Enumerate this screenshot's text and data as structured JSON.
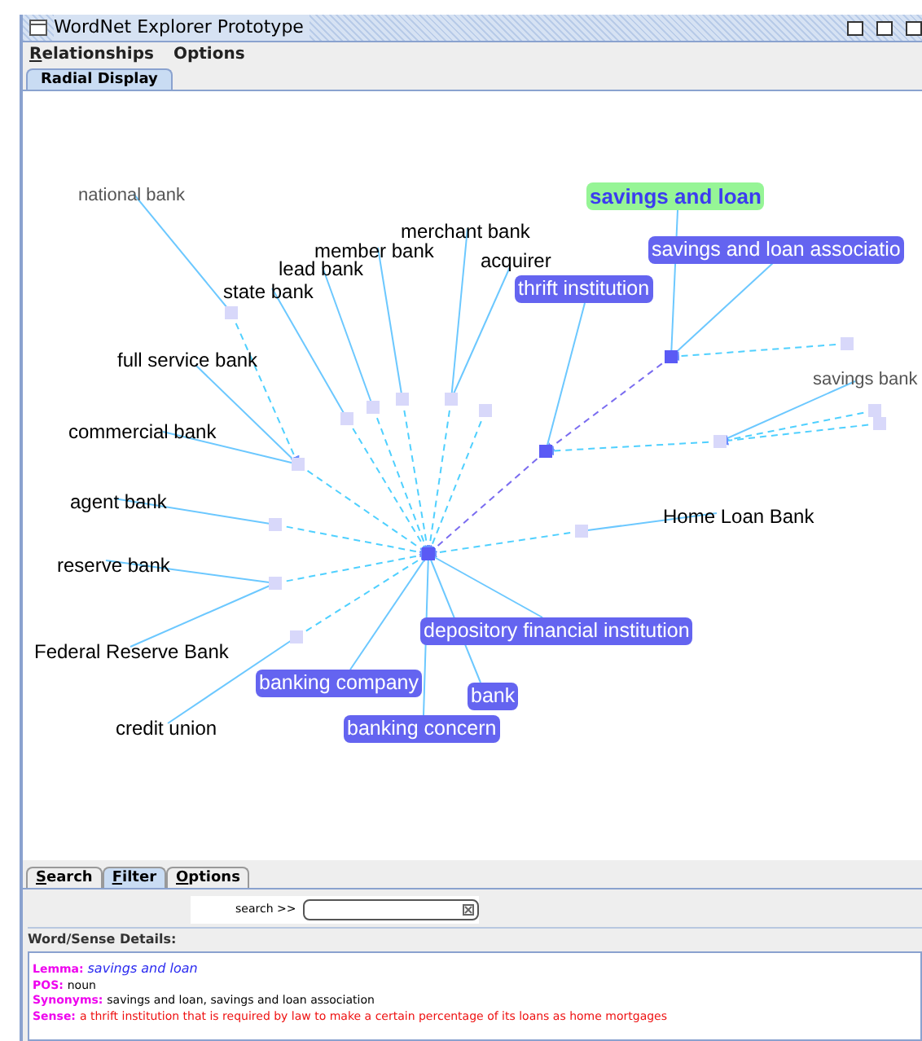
{
  "window": {
    "title": "WordNet Explorer Prototype"
  },
  "menu": [
    "Relationships",
    "Options"
  ],
  "tabs": [
    {
      "label": "Radial Display",
      "selected": true
    }
  ],
  "graph": {
    "nodes": [
      {
        "label": "national bank",
        "kind": "faded"
      },
      {
        "label": "merchant bank",
        "kind": "plain"
      },
      {
        "label": "member bank",
        "kind": "plain"
      },
      {
        "label": "lead bank",
        "kind": "plain"
      },
      {
        "label": "acquirer",
        "kind": "plain"
      },
      {
        "label": "state bank",
        "kind": "plain"
      },
      {
        "label": "full service bank",
        "kind": "plain"
      },
      {
        "label": "commercial bank",
        "kind": "plain"
      },
      {
        "label": "agent bank",
        "kind": "plain"
      },
      {
        "label": "reserve bank",
        "kind": "plain"
      },
      {
        "label": "Federal Reserve Bank",
        "kind": "plain"
      },
      {
        "label": "credit union",
        "kind": "plain"
      },
      {
        "label": "savings and loan",
        "kind": "focus"
      },
      {
        "label": "savings and loan associatio",
        "kind": "synset"
      },
      {
        "label": "thrift institution",
        "kind": "synset"
      },
      {
        "label": "savings bank",
        "kind": "faded"
      },
      {
        "label": "Home Loan Bank",
        "kind": "plain"
      },
      {
        "label": "depository financial institution",
        "kind": "synset"
      },
      {
        "label": "banking company",
        "kind": "synset"
      },
      {
        "label": "bank",
        "kind": "synset"
      },
      {
        "label": "banking concern",
        "kind": "synset"
      }
    ]
  },
  "bottom_tabs": [
    {
      "label": "Search",
      "selected": false
    },
    {
      "label": "Filter",
      "selected": true
    },
    {
      "label": "Options",
      "selected": false
    }
  ],
  "search": {
    "label": "search >>"
  },
  "details": {
    "title": "Word/Sense Details:",
    "lines": [
      {
        "label": "Lemma:",
        "value": "savings and loan",
        "kind": "lemma"
      },
      {
        "label": "POS:",
        "value": "noun",
        "kind": "plain"
      },
      {
        "label": "Synonyms:",
        "value": "savings and loan, savings and loan association",
        "kind": "plain"
      },
      {
        "label": "Sense:",
        "value": "a thrift institution that is required by law to make a certain percentage of its loans as home mortgages",
        "kind": "sense"
      }
    ]
  }
}
